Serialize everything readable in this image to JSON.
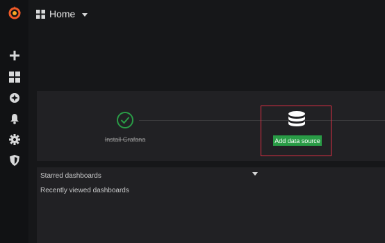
{
  "header": {
    "title": "Home"
  },
  "sidebar": {
    "items": [
      {
        "icon": "plus-icon"
      },
      {
        "icon": "dashboards-icon"
      },
      {
        "icon": "compass-icon"
      },
      {
        "icon": "bell-icon"
      },
      {
        "icon": "gear-icon"
      },
      {
        "icon": "shield-icon"
      }
    ]
  },
  "onboarding": {
    "step1_label": "Install Grafana",
    "step2_button": "Add data source"
  },
  "home": {
    "starred_label": "Starred dashboards",
    "recent_label": "Recently viewed dashboards"
  },
  "colors": {
    "accent_green": "#299c46",
    "highlight_red": "#e02f44",
    "logo_orange": "#f05a28"
  }
}
